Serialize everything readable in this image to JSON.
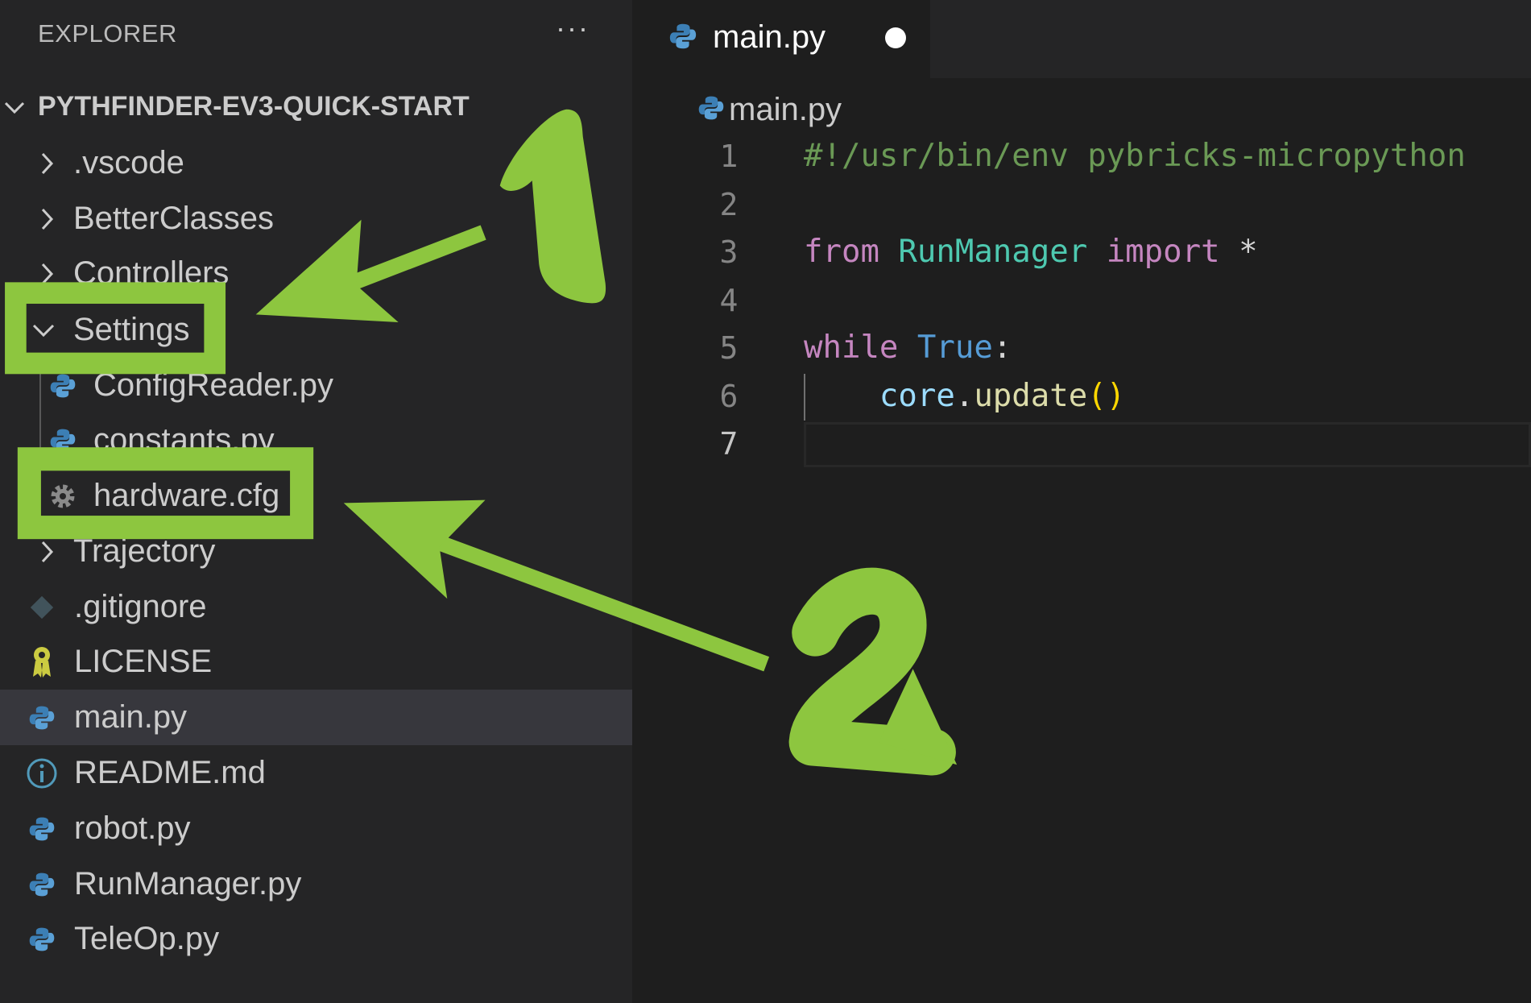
{
  "sidebar": {
    "header": "EXPLORER",
    "more_label": "···",
    "root": "PYTHFINDER-EV3-QUICK-START",
    "items": [
      {
        "label": ".vscode",
        "kind": "folder",
        "icon": "chevron-right-icon"
      },
      {
        "label": "BetterClasses",
        "kind": "folder",
        "icon": "chevron-right-icon"
      },
      {
        "label": "Controllers",
        "kind": "folder",
        "icon": "chevron-right-icon"
      },
      {
        "label": "Settings",
        "kind": "folder-open",
        "icon": "chevron-down-icon"
      },
      {
        "label": "ConfigReader.py",
        "kind": "python",
        "icon": "python-icon"
      },
      {
        "label": "constants.py",
        "kind": "python",
        "icon": "python-icon"
      },
      {
        "label": "hardware.cfg",
        "kind": "config",
        "icon": "gear-icon"
      },
      {
        "label": "Trajectory",
        "kind": "folder",
        "icon": "chevron-right-icon"
      },
      {
        "label": ".gitignore",
        "kind": "git",
        "icon": "git-diamond-icon"
      },
      {
        "label": "LICENSE",
        "kind": "license",
        "icon": "license-ribbon-icon"
      },
      {
        "label": "main.py",
        "kind": "python",
        "icon": "python-icon",
        "selected": true
      },
      {
        "label": "README.md",
        "kind": "readme",
        "icon": "info-icon"
      },
      {
        "label": "robot.py",
        "kind": "python",
        "icon": "python-icon"
      },
      {
        "label": "RunManager.py",
        "kind": "python",
        "icon": "python-icon"
      },
      {
        "label": "TeleOp.py",
        "kind": "python",
        "icon": "python-icon"
      }
    ]
  },
  "editor": {
    "tab": {
      "label": "main.py",
      "modified": true
    },
    "breadcrumb": "main.py",
    "line_numbers": [
      "1",
      "2",
      "3",
      "4",
      "5",
      "6",
      "7"
    ],
    "current_line": "7",
    "code": {
      "l1": "#!/usr/bin/env pybricks-micropython",
      "l3_from": "from",
      "l3_module": "RunManager",
      "l3_import": "import",
      "l3_star": "*",
      "l5_while": "while",
      "l5_true": "True",
      "l5_colon": ":",
      "l6_obj": "core",
      "l6_dot": ".",
      "l6_fn": "update",
      "l6_parens": "()"
    }
  },
  "annotations": {
    "color": "#8dc63f",
    "step1": "1",
    "step2": "2"
  },
  "colors": {
    "sidebar_bg": "#252526",
    "editor_bg": "#1e1e1e",
    "comment": "#6a9955",
    "keyword": "#c586c0",
    "class": "#4ec9b0",
    "constant": "#569cd6",
    "variable": "#9cdcfe",
    "function": "#dcdcaa",
    "bracket": "#ffd700"
  }
}
